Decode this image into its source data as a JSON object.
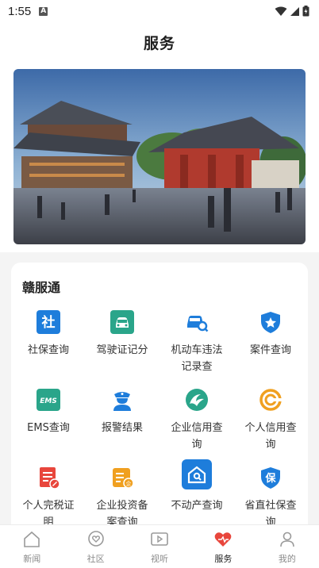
{
  "status": {
    "time": "1:55",
    "notice": "A"
  },
  "header": {
    "title": "服务"
  },
  "section": {
    "title": "赣服通"
  },
  "services": [
    {
      "label": "社保查询",
      "icon": "social-security-icon"
    },
    {
      "label": "驾驶证记分",
      "icon": "driver-license-icon"
    },
    {
      "label": "机动车违法记录查",
      "icon": "vehicle-violation-icon"
    },
    {
      "label": "案件查询",
      "icon": "police-badge-icon"
    },
    {
      "label": "EMS查询",
      "icon": "ems-icon"
    },
    {
      "label": "报警结果",
      "icon": "police-officer-icon"
    },
    {
      "label": "企业信用查询",
      "icon": "enterprise-credit-icon"
    },
    {
      "label": "个人信用查询",
      "icon": "personal-credit-icon"
    },
    {
      "label": "个人完税证明",
      "icon": "tax-certificate-icon"
    },
    {
      "label": "企业投资备案查询",
      "icon": "investment-record-icon"
    },
    {
      "label": "不动产查询",
      "icon": "real-estate-icon"
    },
    {
      "label": "省直社保查询",
      "icon": "provincial-insurance-icon"
    }
  ],
  "nav": [
    {
      "label": "新闻",
      "icon": "home-icon"
    },
    {
      "label": "社区",
      "icon": "heart-chat-icon"
    },
    {
      "label": "视听",
      "icon": "video-icon"
    },
    {
      "label": "服务",
      "icon": "service-heart-icon"
    },
    {
      "label": "我的",
      "icon": "profile-icon"
    }
  ],
  "colors": {
    "blue": "#1e7ddb",
    "teal": "#2aa58a",
    "orange": "#f0a020",
    "red": "#e8463c",
    "active": "#e8463c"
  }
}
